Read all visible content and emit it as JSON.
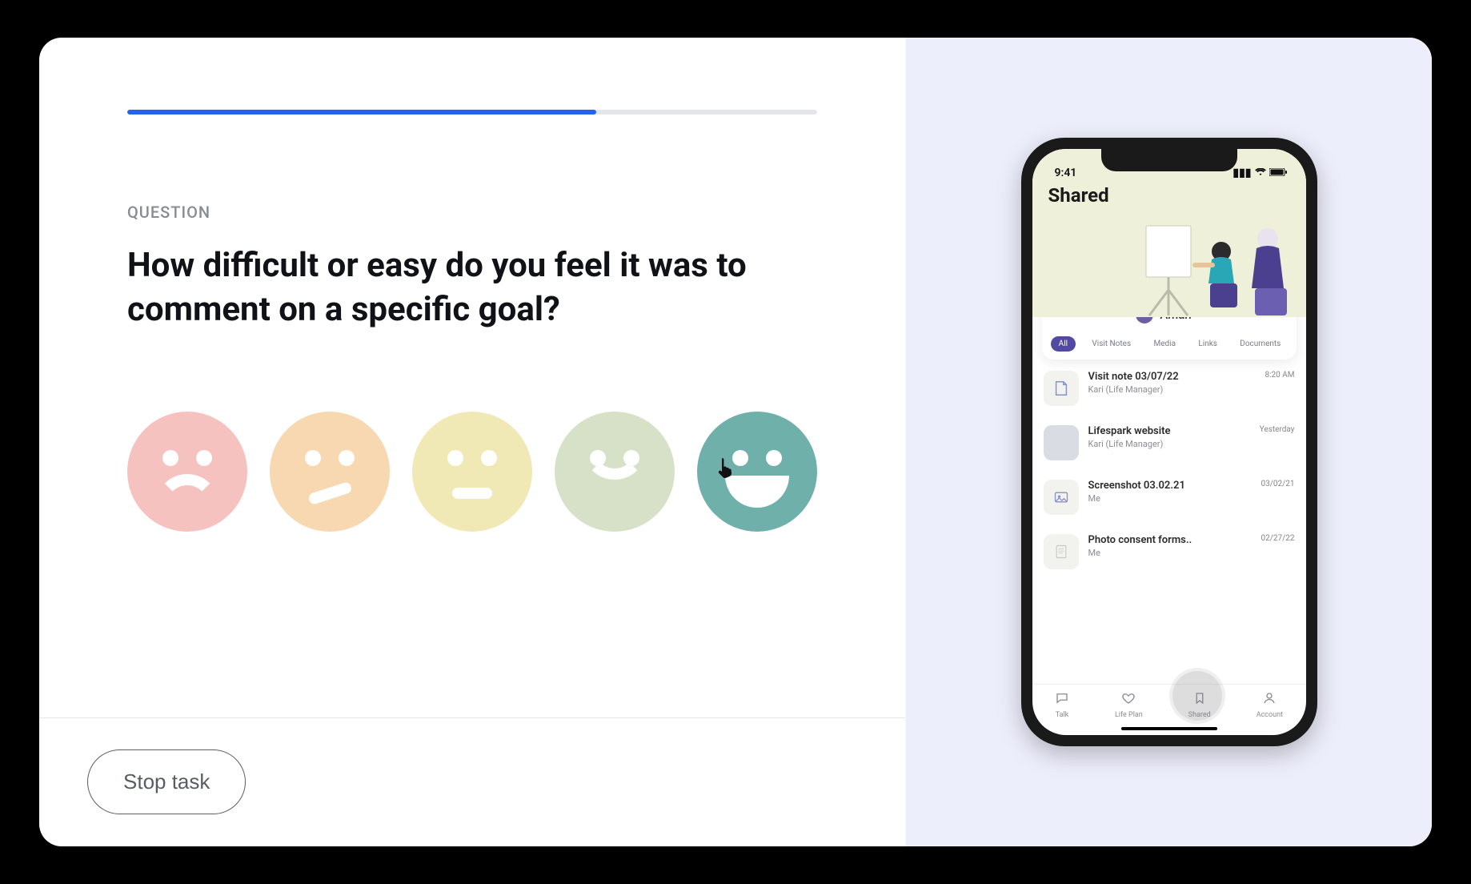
{
  "progress": {
    "percent": 68
  },
  "survey": {
    "overline": "QUESTION",
    "question": "How difficult or easy do you feel it was to comment on a specific goal?",
    "options": [
      {
        "id": "very-difficult",
        "label": "Very difficult"
      },
      {
        "id": "difficult",
        "label": "Difficult"
      },
      {
        "id": "neutral",
        "label": "Neutral"
      },
      {
        "id": "easy",
        "label": "Easy"
      },
      {
        "id": "very-easy",
        "label": "Very easy"
      }
    ],
    "hovered_option_index": 4
  },
  "footer": {
    "stop_label": "Stop task"
  },
  "phone": {
    "status": {
      "time": "9:41"
    },
    "header": {
      "title": "Shared"
    },
    "user": {
      "name": "Amah"
    },
    "tabs": [
      {
        "label": "All",
        "active": true
      },
      {
        "label": "Visit Notes",
        "active": false
      },
      {
        "label": "Media",
        "active": false
      },
      {
        "label": "Links",
        "active": false
      },
      {
        "label": "Documents",
        "active": false
      }
    ],
    "items": [
      {
        "icon": "note",
        "title": "Visit note 03/07/22",
        "subtitle": "Kari (Life Manager)",
        "time": "8:20 AM"
      },
      {
        "icon": "photo",
        "title": "Lifespark website",
        "subtitle": "Kari (Life Manager)",
        "time": "Yesterday"
      },
      {
        "icon": "image",
        "title": "Screenshot 03.02.21",
        "subtitle": "Me",
        "time": "03/02/21"
      },
      {
        "icon": "doc",
        "title": "Photo consent forms..",
        "subtitle": "Me",
        "time": "02/27/22"
      }
    ],
    "tabbar": [
      {
        "label": "Talk",
        "icon": "chat"
      },
      {
        "label": "Life Plan",
        "icon": "heart"
      },
      {
        "label": "Shared",
        "icon": "bookmark"
      },
      {
        "label": "Account",
        "icon": "person"
      }
    ]
  },
  "colors": {
    "progress": "#2563eb",
    "faces": [
      "#f5c2bf",
      "#f7d8b0",
      "#f1e9b5",
      "#d6e1c8",
      "#6fb0ab"
    ],
    "phone_hero": "#eef0d9",
    "phone_accent": "#5348a3",
    "right_bg": "#edeefb"
  }
}
